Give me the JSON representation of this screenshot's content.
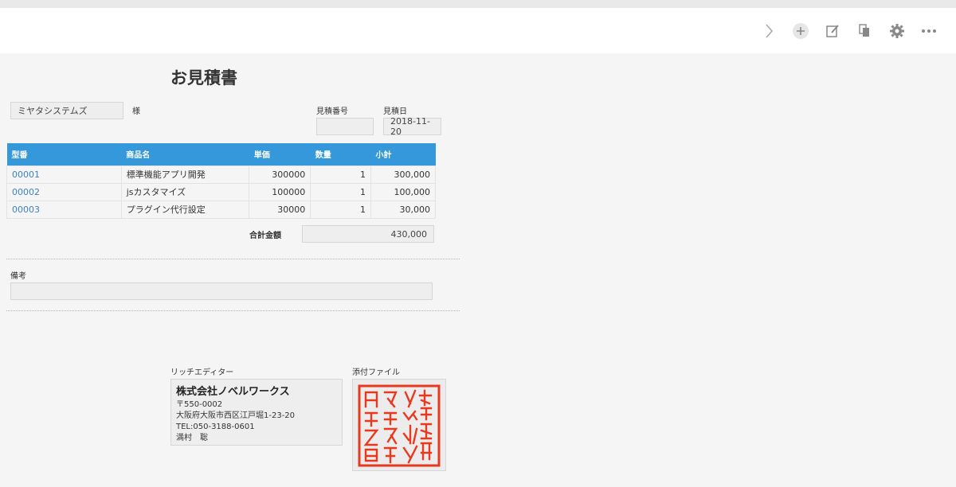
{
  "header": {
    "icons": [
      "chevron-right-icon",
      "plus-icon",
      "edit-icon",
      "copy-icon",
      "gear-icon",
      "more-icon"
    ]
  },
  "form": {
    "title": "お見積書",
    "customer_name": "ミヤタシステムズ",
    "honorific": "様",
    "estimate_number_label": "見積番号",
    "estimate_number_value": "",
    "estimate_date_label": "見積日",
    "estimate_date_value": "2018-11-20"
  },
  "table": {
    "headers": [
      "型番",
      "商品名",
      "単価",
      "数量",
      "小計"
    ],
    "rows": [
      {
        "code": "00001",
        "name": "標準機能アプリ開発",
        "price": "300000",
        "qty": "1",
        "subtotal": "300,000"
      },
      {
        "code": "00002",
        "name": "jsカスタマイズ",
        "price": "100000",
        "qty": "1",
        "subtotal": "100,000"
      },
      {
        "code": "00003",
        "name": "プラグイン代行設定",
        "price": "30000",
        "qty": "1",
        "subtotal": "30,000"
      }
    ]
  },
  "total": {
    "label": "合計金額",
    "value": "430,000"
  },
  "remarks": {
    "label": "備考",
    "value": ""
  },
  "rich_editor": {
    "label": "リッチエディター",
    "company": "株式会社ノベルワークス",
    "lines": [
      "〒550-0002",
      "大阪府大阪市西区江戸堀1-23-20",
      "TEL:050-3188-0601",
      "満村　聡"
    ]
  },
  "attachment": {
    "label": "添付ファイル",
    "stamp_text": "株式会社ノベルワークス之印"
  },
  "colors": {
    "accent": "#3498db",
    "link": "#3b82c4",
    "stamp": "#e8391f"
  }
}
